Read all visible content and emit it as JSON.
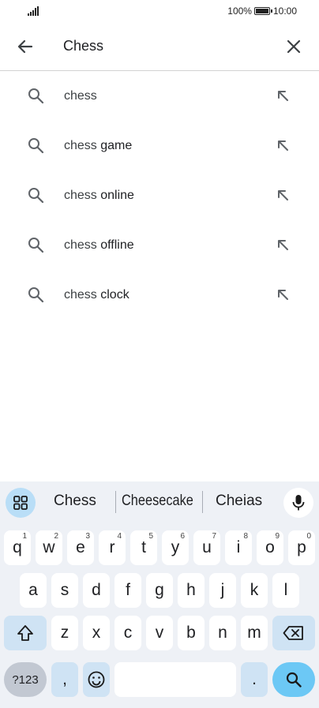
{
  "status_bar": {
    "battery_percent": "100%",
    "time": "10:00",
    "icons": [
      "signal-icon",
      "battery-icon"
    ]
  },
  "search": {
    "query": "Chess",
    "back_icon": "arrow-left-icon",
    "clear_icon": "close-icon"
  },
  "suggestions": [
    {
      "prefix": "chess",
      "suffix": ""
    },
    {
      "prefix": "chess",
      "suffix": " game"
    },
    {
      "prefix": "chess",
      "suffix": " online"
    },
    {
      "prefix": "chess",
      "suffix": " offline"
    },
    {
      "prefix": "chess",
      "suffix": " clock"
    }
  ],
  "keyboard": {
    "word_suggestions": [
      "Chess",
      "Cheesecake",
      "Cheias"
    ],
    "row1": [
      {
        "key": "q",
        "hint": "1"
      },
      {
        "key": "w",
        "hint": "2"
      },
      {
        "key": "e",
        "hint": "3"
      },
      {
        "key": "r",
        "hint": "4"
      },
      {
        "key": "t",
        "hint": "5"
      },
      {
        "key": "y",
        "hint": "6"
      },
      {
        "key": "u",
        "hint": "7"
      },
      {
        "key": "i",
        "hint": "8"
      },
      {
        "key": "o",
        "hint": "9"
      },
      {
        "key": "p",
        "hint": "0"
      }
    ],
    "row2": [
      "a",
      "s",
      "d",
      "f",
      "g",
      "h",
      "j",
      "k",
      "l"
    ],
    "row3": [
      "z",
      "x",
      "c",
      "v",
      "b",
      "n",
      "m"
    ],
    "symbols_label": "?123",
    "comma_label": ",",
    "period_label": ".",
    "colors": {
      "background": "#eef1f6",
      "key": "#ffffff",
      "modifier": "#cfe3f4",
      "action": "#6cc8f5"
    }
  }
}
